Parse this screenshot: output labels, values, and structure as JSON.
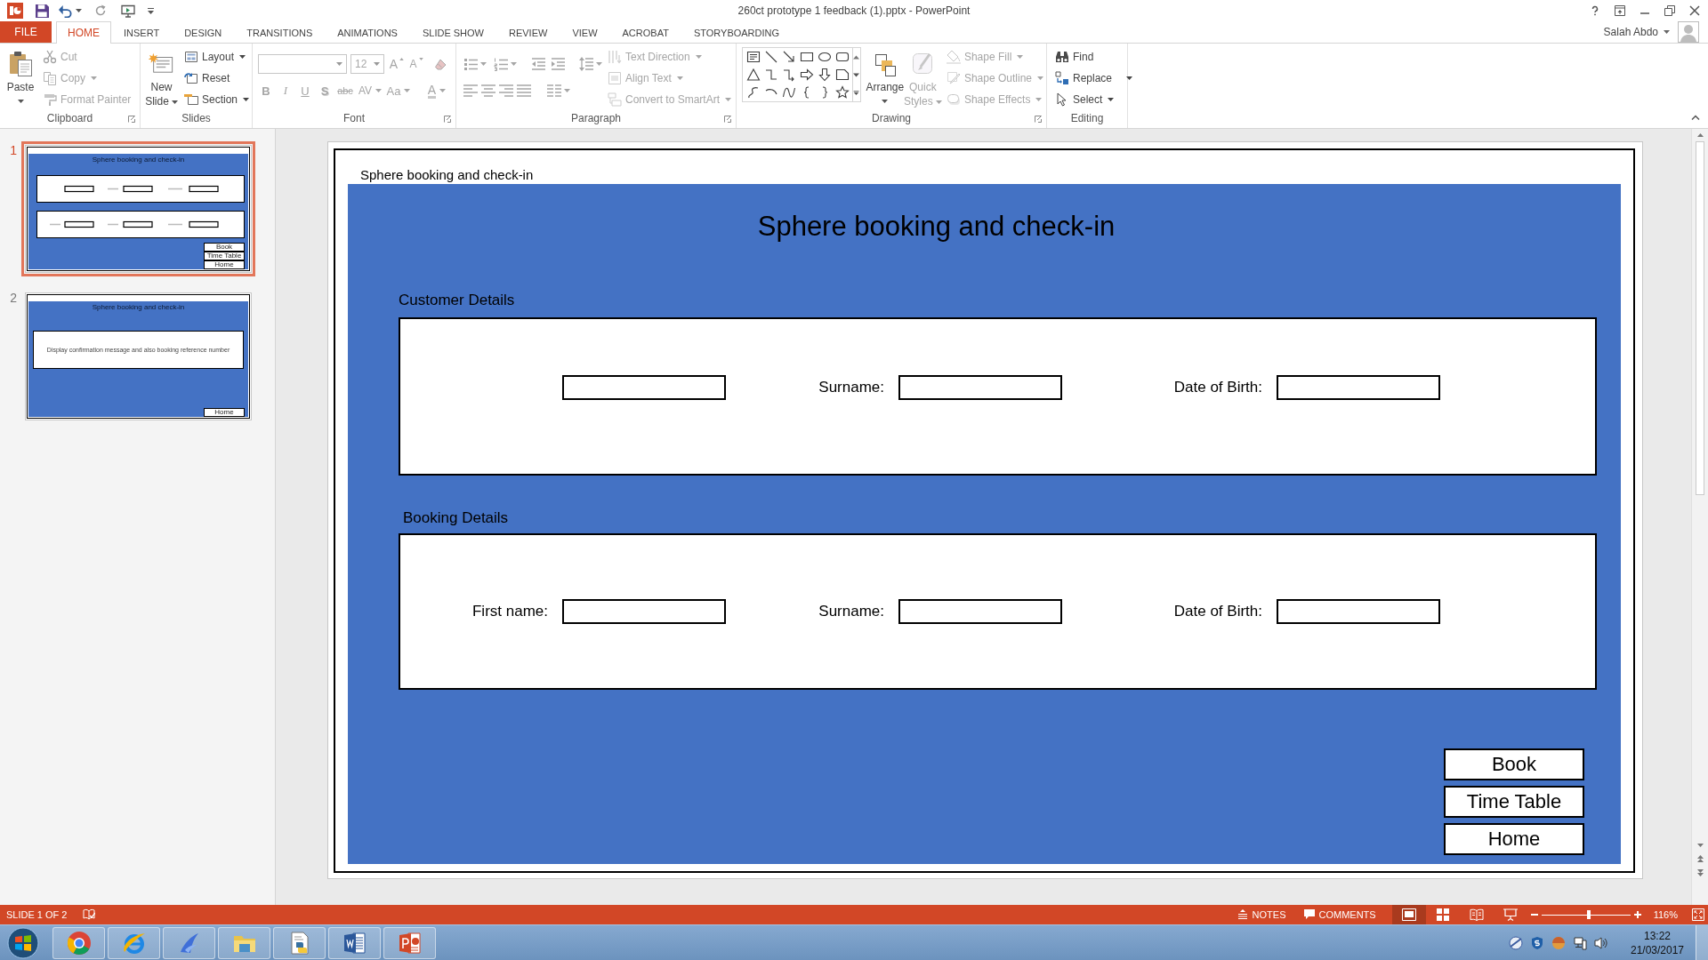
{
  "window": {
    "title": "260ct prototype 1 feedback (1).pptx - PowerPoint",
    "user": "Salah Abdo"
  },
  "ribbon_tabs": [
    {
      "label": "FILE",
      "kind": "backstage",
      "selected": false
    },
    {
      "label": "HOME",
      "kind": "tab",
      "selected": true
    },
    {
      "label": "INSERT",
      "kind": "tab",
      "selected": false
    },
    {
      "label": "DESIGN",
      "kind": "tab",
      "selected": false
    },
    {
      "label": "TRANSITIONS",
      "kind": "tab",
      "selected": false
    },
    {
      "label": "ANIMATIONS",
      "kind": "tab",
      "selected": false
    },
    {
      "label": "SLIDE SHOW",
      "kind": "tab",
      "selected": false
    },
    {
      "label": "REVIEW",
      "kind": "tab",
      "selected": false
    },
    {
      "label": "VIEW",
      "kind": "tab",
      "selected": false
    },
    {
      "label": "ACROBAT",
      "kind": "tab",
      "selected": false
    },
    {
      "label": "STORYBOARDING",
      "kind": "tab",
      "selected": false
    }
  ],
  "ribbon_groups": [
    {
      "kind": "clipboard",
      "label": "Clipboard",
      "dialog_launcher": true,
      "commands": [
        {
          "label": "Paste",
          "disabled": false,
          "dropdown": true
        },
        {
          "label": "Cut",
          "disabled": true,
          "dropdown": false
        },
        {
          "label": "Copy",
          "disabled": true,
          "dropdown": true
        },
        {
          "label": "Format Painter",
          "disabled": true,
          "dropdown": false
        }
      ]
    },
    {
      "kind": "slides",
      "label": "Slides",
      "dialog_launcher": false,
      "commands": [
        {
          "label": "New Slide",
          "disabled": false,
          "dropdown": true
        },
        {
          "label": "Layout",
          "disabled": false,
          "dropdown": true
        },
        {
          "label": "Reset",
          "disabled": false,
          "dropdown": false
        },
        {
          "label": "Section",
          "disabled": false,
          "dropdown": true
        }
      ]
    },
    {
      "kind": "font",
      "label": "Font",
      "dialog_launcher": true,
      "disabled": true,
      "font_size": "12",
      "size_buttons": [
        "A",
        "A"
      ],
      "format_buttons": [
        {
          "label": "B",
          "dropdown": false
        },
        {
          "label": "I",
          "dropdown": false
        },
        {
          "label": "U",
          "dropdown": false
        },
        {
          "label": "S",
          "dropdown": false
        },
        {
          "label": "abc",
          "dropdown": false
        },
        {
          "label": "AV",
          "dropdown": true
        },
        {
          "label": "Aa",
          "dropdown": true
        },
        {
          "label": "A",
          "dropdown": true
        }
      ]
    },
    {
      "kind": "paragraph",
      "label": "Paragraph",
      "dialog_launcher": true,
      "disabled": true,
      "commands": [
        {
          "label": "Text Direction",
          "dropdown": true
        },
        {
          "label": "Align Text",
          "dropdown": true
        },
        {
          "label": "Convert to SmartArt",
          "dropdown": true
        }
      ]
    },
    {
      "kind": "drawing",
      "label": "Drawing",
      "dialog_launcher": true,
      "commands": [
        {
          "label": "Arrange",
          "disabled": false,
          "dropdown": true
        },
        {
          "label": "Quick Styles",
          "disabled": true,
          "dropdown": true
        },
        {
          "label": "Shape Fill",
          "disabled": true,
          "dropdown": true
        },
        {
          "label": "Shape Outline",
          "disabled": true,
          "dropdown": true
        },
        {
          "label": "Shape Effects",
          "disabled": true,
          "dropdown": true
        }
      ]
    },
    {
      "kind": "editing",
      "label": "Editing",
      "dialog_launcher": false,
      "commands": [
        {
          "label": "Find",
          "disabled": false,
          "dropdown": false
        },
        {
          "label": "Replace",
          "disabled": false,
          "dropdown": true
        },
        {
          "label": "Select",
          "disabled": false,
          "dropdown": true
        }
      ]
    }
  ],
  "slides_pane": [
    {
      "number": "1",
      "kind": "form",
      "selected": true,
      "title": "Sphere booking and check-in",
      "buttons": [
        "Book",
        "Time Table",
        "Home"
      ]
    },
    {
      "number": "2",
      "kind": "message",
      "selected": false,
      "title": "Sphere booking and check-in",
      "message": "Display confirmation message and also booking reference number",
      "buttons": [
        "Home"
      ]
    }
  ],
  "slide": {
    "header": "Sphere booking and check-in",
    "title": "Sphere booking and check-in",
    "sections": [
      {
        "heading": "Customer Details",
        "fields": [
          {
            "kind": "text_input"
          },
          {
            "kind": "text_input",
            "label": "Surname:"
          },
          {
            "kind": "text_input",
            "label": "Date of Birth:"
          }
        ]
      },
      {
        "heading": "Booking Details",
        "fields": [
          {
            "kind": "text_input",
            "label": "First name:"
          },
          {
            "kind": "text_input",
            "label": "Surname:"
          },
          {
            "kind": "text_input",
            "label": "Date of Birth:"
          }
        ]
      }
    ],
    "buttons": [
      "Book",
      "Time Table",
      "Home"
    ]
  },
  "status_bar": {
    "slide_info": "SLIDE 1 OF 2",
    "notes": "NOTES",
    "comments": "COMMENTS",
    "views": [
      {
        "selected": true
      },
      {
        "selected": false
      },
      {
        "selected": false
      },
      {
        "selected": false
      }
    ],
    "zoom": {
      "level": 0.53,
      "reading": "116%"
    }
  },
  "taskbar": {
    "clock": {
      "time": "13:22",
      "date": "21/03/2017"
    }
  }
}
